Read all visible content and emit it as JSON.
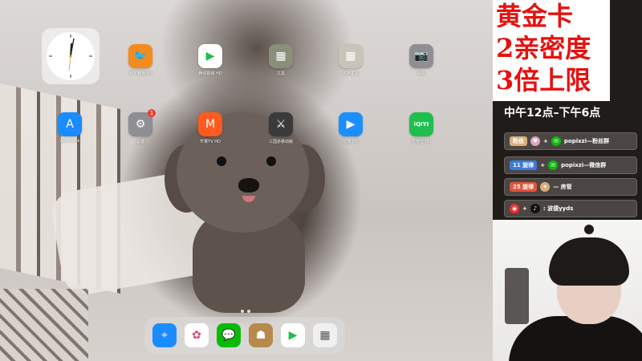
{
  "ipad": {
    "apps_row1": [
      {
        "label": "和平精英HD",
        "icon": "game-icon",
        "color": "#f58b1f",
        "glyph": "🐦"
      },
      {
        "label": "腾讯视频 HD",
        "icon": "video-icon",
        "color": "#ffffff",
        "glyph": "▶"
      },
      {
        "label": "工具",
        "icon": "folder-icon",
        "color": "#8a8f7a",
        "glyph": "▦"
      },
      {
        "label": "实用工具",
        "icon": "folder-icon",
        "color": "#c9c4b8",
        "glyph": "▦"
      },
      {
        "label": "相机",
        "icon": "camera-icon",
        "color": "#8e8e93",
        "glyph": "📷"
      }
    ],
    "apps_row2": [
      {
        "label": "App Store",
        "icon": "app-store-icon",
        "color": "#1a8cff",
        "glyph": "A",
        "badge": ""
      },
      {
        "label": "设置",
        "icon": "settings-icon",
        "color": "#8e8e93",
        "glyph": "⚙",
        "badge": "1"
      },
      {
        "label": "芒果TV HD",
        "icon": "mango-tv-icon",
        "color": "#ff5a1f",
        "glyph": "M",
        "badge": ""
      },
      {
        "label": "三国杀移动版",
        "icon": "game-icon",
        "color": "#3a3a3a",
        "glyph": "⚔",
        "badge": ""
      },
      {
        "label": "优酷 HD",
        "icon": "youku-icon",
        "color": "#1c8fff",
        "glyph": "▶",
        "badge": ""
      },
      {
        "label": "爱奇艺 HD",
        "icon": "iqiyi-icon",
        "color": "#1ebf4d",
        "glyph": "iQIYI",
        "badge": ""
      }
    ],
    "dock": [
      {
        "name": "safari-icon",
        "color": "#1a8cff",
        "glyph": "⌖"
      },
      {
        "name": "photos-icon",
        "color": "#ffffff",
        "glyph": "✿"
      },
      {
        "name": "wechat-icon",
        "color": "#09bb07",
        "glyph": "💬"
      },
      {
        "name": "pubg-icon",
        "color": "#b7894a",
        "glyph": "☗"
      },
      {
        "name": "tencent-video-icon",
        "color": "#ffffff",
        "glyph": "▶"
      },
      {
        "name": "app-library-icon",
        "color": "#f0f0f0",
        "glyph": "▦"
      }
    ]
  },
  "panel": {
    "promo_lines": [
      "黄金卡",
      "2亲密度",
      "3倍上限"
    ],
    "hours": "中午12点–下午6点",
    "bars": [
      {
        "pill": "粉丝",
        "pill_color": "#d8b07a",
        "text": "popixzi—粉丝群"
      },
      {
        "pill": "11 旋律",
        "pill_color": "#3b7be0",
        "text": "popixzi—微信群"
      },
      {
        "pill": "25 旋律",
        "pill_color": "#e0553b",
        "text": "—  房管"
      },
      {
        "pill": "",
        "pill_color": "",
        "text": ": 波德yyds"
      }
    ]
  }
}
